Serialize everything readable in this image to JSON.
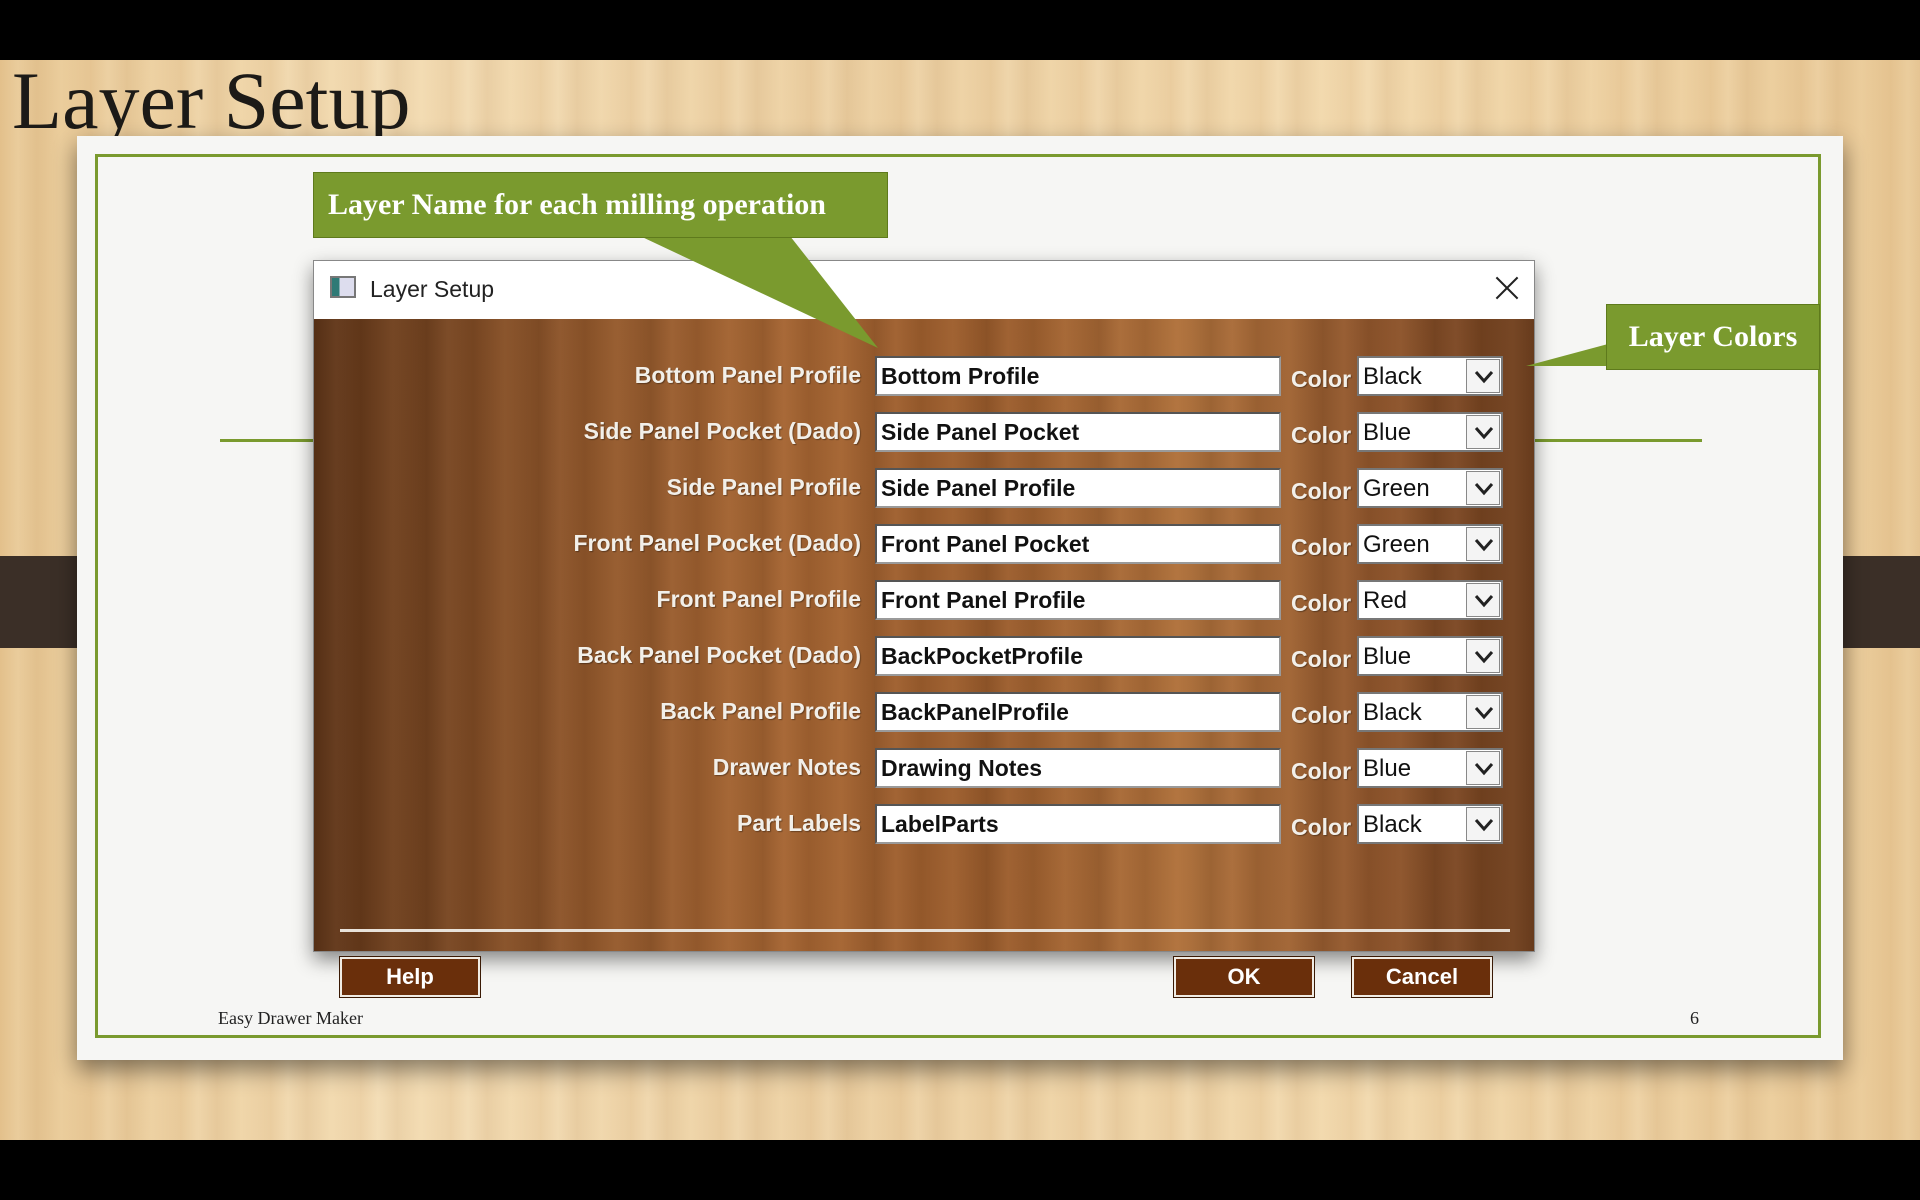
{
  "slide": {
    "title": "Layer Setup",
    "footer_left": "Easy Drawer Maker",
    "page_number": "6"
  },
  "callouts": {
    "layer_name": "Layer Name for each milling operation",
    "layer_colors": "Layer Colors"
  },
  "dialog": {
    "title": "Layer Setup",
    "color_label": "Color",
    "rows": [
      {
        "label": "Bottom Panel Profile",
        "value": "Bottom Profile",
        "color": "Black"
      },
      {
        "label": "Side Panel Pocket (Dado)",
        "value": "Side Panel Pocket",
        "color": "Blue"
      },
      {
        "label": "Side Panel Profile",
        "value": "Side Panel Profile",
        "color": "Green"
      },
      {
        "label": "Front Panel Pocket (Dado)",
        "value": "Front Panel Pocket",
        "color": "Green"
      },
      {
        "label": "Front Panel Profile",
        "value": "Front Panel Profile",
        "color": "Red"
      },
      {
        "label": "Back Panel Pocket (Dado)",
        "value": "BackPocketProfile",
        "color": "Blue"
      },
      {
        "label": "Back Panel Profile",
        "value": "BackPanelProfile",
        "color": "Black"
      },
      {
        "label": "Drawer Notes",
        "value": "Drawing Notes",
        "color": "Blue"
      },
      {
        "label": "Part Labels",
        "value": "LabelParts",
        "color": "Black"
      }
    ],
    "buttons": {
      "help": "Help",
      "ok": "OK",
      "cancel": "Cancel"
    }
  },
  "icons": {
    "app": "window-app-icon",
    "close": "close-icon",
    "dropdown": "chevron-down-icon"
  },
  "colors": {
    "accent_green": "#7a9a2e",
    "button_brown": "#6a2f0b"
  }
}
